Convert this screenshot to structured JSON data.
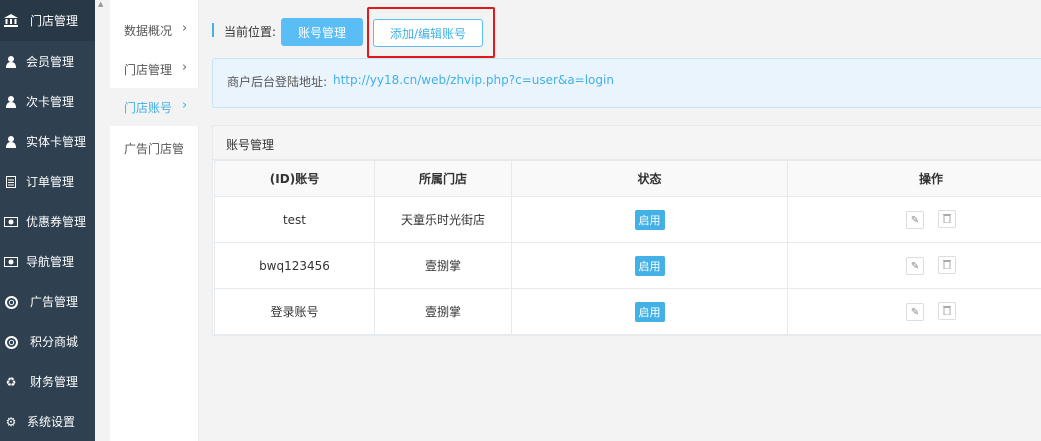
{
  "nav": {
    "items": [
      {
        "label": "门店管理",
        "icon": "bank-icon",
        "active": true
      },
      {
        "label": "会员管理",
        "icon": "user-icon"
      },
      {
        "label": "次卡管理",
        "icon": "user-icon"
      },
      {
        "label": "实体卡管理",
        "icon": "user-icon"
      },
      {
        "label": "订单管理",
        "icon": "document-icon"
      },
      {
        "label": "优惠券管理",
        "icon": "money-icon"
      },
      {
        "label": "导航管理",
        "icon": "money-icon"
      },
      {
        "label": "广告管理",
        "icon": "lifebuoy-icon"
      },
      {
        "label": "积分商城",
        "icon": "lifebuoy-icon"
      },
      {
        "label": "财务管理",
        "icon": "recycle-icon"
      },
      {
        "label": "系统设置",
        "icon": "gear-icon"
      }
    ]
  },
  "subnav": {
    "items": [
      {
        "label": "数据概况"
      },
      {
        "label": "门店管理"
      },
      {
        "label": "门店账号",
        "active": true
      },
      {
        "label": "广告门店管"
      }
    ],
    "arrow": "›"
  },
  "breadcrumb": {
    "label": "当前位置:",
    "current": "账号管理",
    "add": "添加/编辑账号"
  },
  "notice": {
    "label": "商户后台登陆地址:",
    "url": "http://yy18.cn/web/zhvip.php?c=user&a=login"
  },
  "panel": {
    "title": "账号管理",
    "columns": [
      "(ID)账号",
      "所属门店",
      "状态",
      "操作"
    ],
    "rows": [
      {
        "account": "test",
        "store": "天童乐时光街店",
        "status": "启用"
      },
      {
        "account": "bwq123456",
        "store": "壹捌掌",
        "status": "启用"
      },
      {
        "account": "登录账号",
        "store": "壹捌掌",
        "status": "启用"
      }
    ]
  },
  "colors": {
    "nav_bg": "#2f4050",
    "accent": "#43b0e6",
    "highlight": "#e3181c"
  }
}
